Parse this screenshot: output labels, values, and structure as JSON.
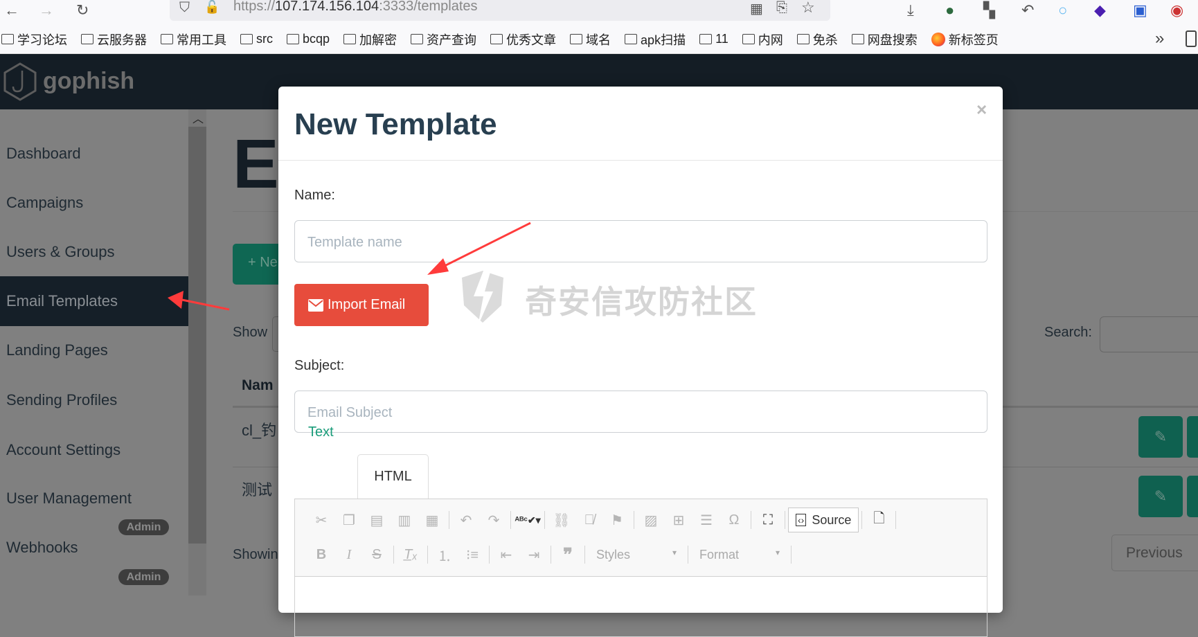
{
  "browser": {
    "url_prefix": "https://",
    "url_host": "107.174.156.104",
    "url_rest": ":3333/templates",
    "bookmarks": [
      "学习论坛",
      "云服务器",
      "常用工具",
      "src",
      "bcqp",
      "加解密",
      "资产查询",
      "优秀文章",
      "域名",
      "apk扫描",
      "11",
      "内网",
      "免杀",
      "网盘搜索",
      "新标签页"
    ],
    "overflow": "»"
  },
  "navbar": {
    "brand": "gophish"
  },
  "sidebar": {
    "items": [
      {
        "label": "Dashboard"
      },
      {
        "label": "Campaigns"
      },
      {
        "label": "Users & Groups"
      },
      {
        "label": "Email Templates",
        "active": true
      },
      {
        "label": "Landing Pages"
      },
      {
        "label": "Sending Profiles"
      },
      {
        "label": "Account Settings"
      },
      {
        "label": "User Management"
      },
      {
        "label": "Webhooks"
      }
    ],
    "badges": [
      "Admin",
      "Admin"
    ]
  },
  "main": {
    "title_visible": "Em",
    "new_button": "+ Ne",
    "show_label": "Show",
    "search_label": "Search:",
    "table_header": "Nam",
    "rows": [
      "cl_钓",
      "测试"
    ],
    "showing": "Showin",
    "previous": "Previous"
  },
  "modal": {
    "title": "New Template",
    "close": "×",
    "name_label": "Name:",
    "name_placeholder": "Template name",
    "import_button": "Import Email",
    "subject_label": "Subject:",
    "subject_placeholder": "Email Subject",
    "tabs": [
      "Text",
      "HTML"
    ],
    "active_tab": "HTML",
    "editor": {
      "source_label": "Source",
      "styles_label": "Styles",
      "format_label": "Format"
    }
  },
  "watermark": "奇安信攻防社区",
  "colors": {
    "navbar": "#141d25",
    "import_button": "#e74c3c",
    "accent_green": "#1a9c7a",
    "title": "#283f50",
    "annotation_arrow": "#ff3b3b"
  }
}
